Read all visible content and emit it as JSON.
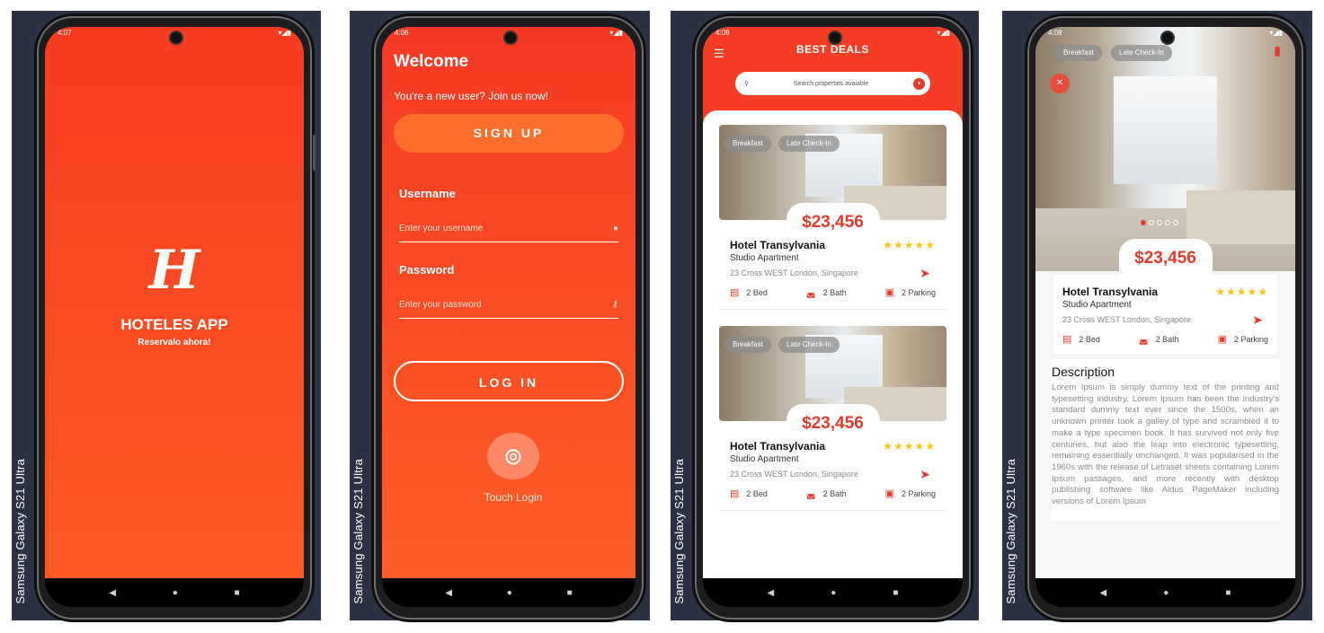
{
  "device": {
    "label": "Samsung Galaxy  S21 Ultra"
  },
  "status": {
    "time1": "4:07",
    "time2": "4:06",
    "time3": "4:08",
    "time4": "4:08"
  },
  "splash": {
    "logo": "H",
    "title": "HOTELES APP",
    "subtitle": "Reservalo ahora!"
  },
  "login": {
    "welcome": "Welcome",
    "new_user": "You're a new user? Join us now!",
    "signup_label": "SIGN UP",
    "username_label": "Username",
    "username_placeholder": "Enter your username",
    "password_label": "Password",
    "password_placeholder": "Enter your password",
    "login_label": "LOG IN",
    "touch_login": "Touch Login"
  },
  "deals": {
    "title": "BEST DEALS",
    "search_placeholder": "Search properties avaiable",
    "cards": [
      {
        "tag1": "Breakfast",
        "tag2": "Late Check-In",
        "price": "$23,456",
        "name": "Hotel Transylvania",
        "type": "Studio Apartment",
        "address": "23 Cross WEST London, Singapore",
        "rating": 5,
        "bed": "2 Bed",
        "bath": "2 Bath",
        "parking": "2 Parking"
      },
      {
        "tag1": "Breakfast",
        "tag2": "Late Check-In",
        "price": "$23,456",
        "name": "Hotel Transylvania",
        "type": "Studio Apartment",
        "address": "23 Cross WEST London, Singapore",
        "rating": 5,
        "bed": "2 Bed",
        "bath": "2 Bath",
        "parking": "2 Parking"
      }
    ]
  },
  "detail": {
    "tag1": "Breakfast",
    "tag2": "Late Check-In",
    "price": "$23,456",
    "name": "Hotel Transylvania",
    "type": "Studio Apartment",
    "address": "23 Cross WEST London, Singapore",
    "rating": 5,
    "bed": "2 Bed",
    "bath": "2 Bath",
    "parking": "2 Parking",
    "carousel_pages": 5,
    "carousel_active": 1,
    "description_title": "Description",
    "description": "Lorem Ipsum is simply dummy text of the printing and typesetting industry. Lorem Ipsum has been the industry's standard dummy text ever since the 1500s, when an unknown printer took a galley of type and scrambled it to make a type specimen book. It has survived not only five centuries, but also the leap into electronic typesetting, remaining essentially unchanged. It was popularised in the 1960s with the release of Letraset sheets containing Lorem Ipsum passages, and more recently with desktop publishing software like Aldus PageMaker including versions of Lorem Ipsum"
  },
  "colors": {
    "primary": "#f43d24",
    "accent": "#e33b2c",
    "star": "#f5c518",
    "panel": "#2c3143"
  },
  "icons": [
    "menu-icon",
    "search-icon",
    "chevron-down-icon",
    "user-icon",
    "key-icon",
    "fingerprint-icon",
    "navigation-icon",
    "bed-icon",
    "bath-icon",
    "parking-icon",
    "bookmark-icon",
    "back-icon"
  ]
}
